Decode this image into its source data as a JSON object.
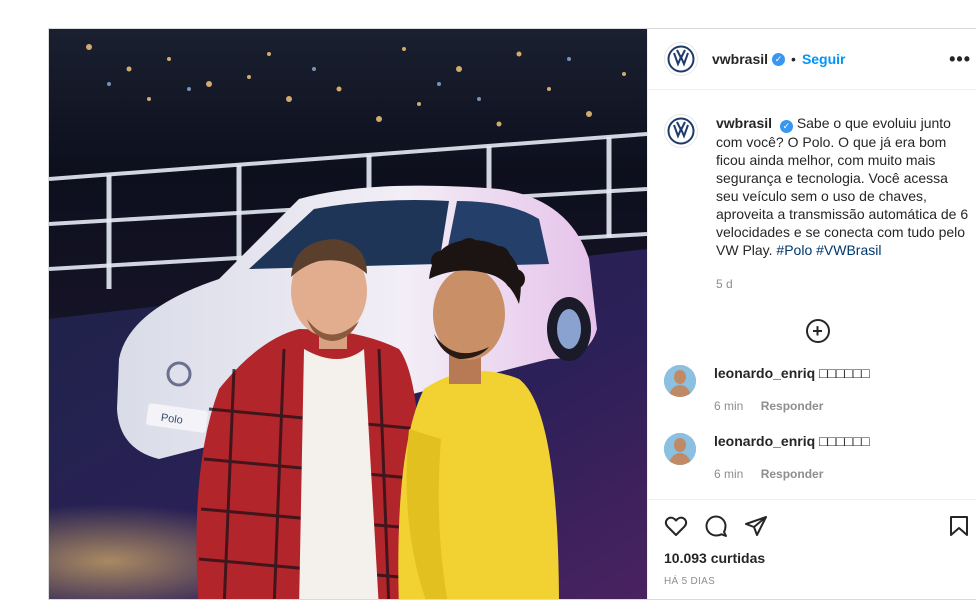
{
  "post": {
    "username": "vwbrasil",
    "verified_icon": "verified-badge-icon",
    "follow_label": "Seguir",
    "dot": "•",
    "more_label": "•••",
    "caption": "Sabe o que evoluiu junto com você? O Polo. O que já era bom ficou ainda melhor, com muito mais segurança e tecnologia. Você acessa seu veículo sem o uso de chaves, aproveita a transmissão automática de 6 velocidades e se conecta com tudo pelo VW Play.",
    "hashtags": "#Polo #VWBrasil",
    "caption_time": "5 d",
    "add_comment_icon": "plus-circle-icon"
  },
  "photo": {
    "plate_text": "Polo"
  },
  "comments": [
    {
      "username": "leonardo_enriq",
      "text": "□□□□□□",
      "time": "6 min",
      "reply_label": "Responder"
    },
    {
      "username": "leonardo_enriq",
      "text": "□□□□□□",
      "time": "6 min",
      "reply_label": "Responder"
    }
  ],
  "actions": {
    "icons": [
      "heart-icon",
      "comment-icon",
      "share-icon",
      "bookmark-icon"
    ],
    "likes": "10.093 curtidas",
    "posted_ago": "HÁ 5 DIAS"
  },
  "colors": {
    "link_blue": "#0095f6",
    "hashtag_blue": "#00376b",
    "vw_blue": "#1f3b6b"
  }
}
